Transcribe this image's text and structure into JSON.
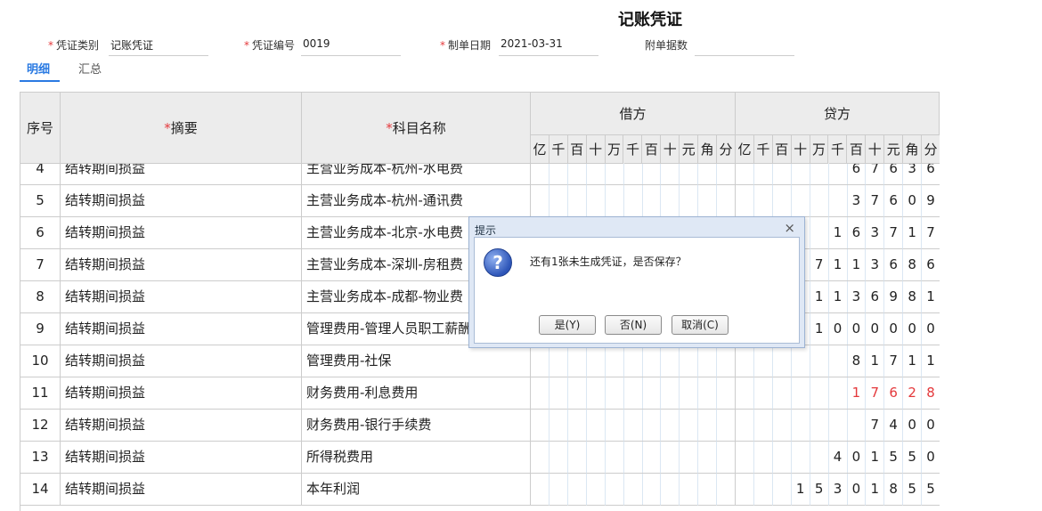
{
  "page": {
    "title": "记账凭证"
  },
  "form": {
    "voucher_type_label": "凭证类别",
    "voucher_type_value": "记账凭证",
    "voucher_no_label": "凭证编号",
    "voucher_no_value": "0019",
    "date_label": "制单日期",
    "date_value": "2021-03-31",
    "attach_label": "附单据数",
    "attach_value": ""
  },
  "tabs": [
    {
      "label": "明细",
      "active": true
    },
    {
      "label": "汇总",
      "active": false
    }
  ],
  "table": {
    "headers": {
      "seq": "序号",
      "summary": "摘要",
      "account": "科目名称",
      "debit": "借方",
      "credit": "贷方"
    },
    "digit_headers": [
      "亿",
      "千",
      "百",
      "十",
      "万",
      "千",
      "百",
      "十",
      "元",
      "角",
      "分"
    ],
    "rows": [
      {
        "seq": "4",
        "summary": "结转期间损益",
        "account": "主营业务成本-杭州-水电费",
        "debit": "",
        "credit": "67636",
        "red": false
      },
      {
        "seq": "5",
        "summary": "结转期间损益",
        "account": "主营业务成本-杭州-通讯费",
        "debit": "",
        "credit": "37609",
        "red": false
      },
      {
        "seq": "6",
        "summary": "结转期间损益",
        "account": "主营业务成本-北京-水电费",
        "debit": "",
        "credit": "163717",
        "red": false
      },
      {
        "seq": "7",
        "summary": "结转期间损益",
        "account": "主营业务成本-深圳-房租费",
        "debit": "",
        "credit": "7113686",
        "red": false
      },
      {
        "seq": "8",
        "summary": "结转期间损益",
        "account": "主营业务成本-成都-物业费",
        "debit": "",
        "credit": "1136981",
        "red": false
      },
      {
        "seq": "9",
        "summary": "结转期间损益",
        "account": "管理费用-管理人员职工薪酬",
        "debit": "",
        "credit": "1000000",
        "red": false
      },
      {
        "seq": "10",
        "summary": "结转期间损益",
        "account": "管理费用-社保",
        "debit": "",
        "credit": "81711",
        "red": false
      },
      {
        "seq": "11",
        "summary": "结转期间损益",
        "account": "财务费用-利息费用",
        "debit": "",
        "credit": "17628",
        "red": true
      },
      {
        "seq": "12",
        "summary": "结转期间损益",
        "account": "财务费用-银行手续费",
        "debit": "",
        "credit": "7400",
        "red": false
      },
      {
        "seq": "13",
        "summary": "结转期间损益",
        "account": "所得税费用",
        "debit": "",
        "credit": "401550",
        "red": false
      },
      {
        "seq": "14",
        "summary": "结转期间损益",
        "account": "本年利润",
        "debit": "",
        "credit": "15301855",
        "red": false
      }
    ]
  },
  "dialog": {
    "title": "提示",
    "close_glyph": "×",
    "icon_glyph": "?",
    "message": "还有1张未生成凭证，是否保存？",
    "yes": "是(Y)",
    "no": "否(N)",
    "cancel": "取消(C)"
  }
}
